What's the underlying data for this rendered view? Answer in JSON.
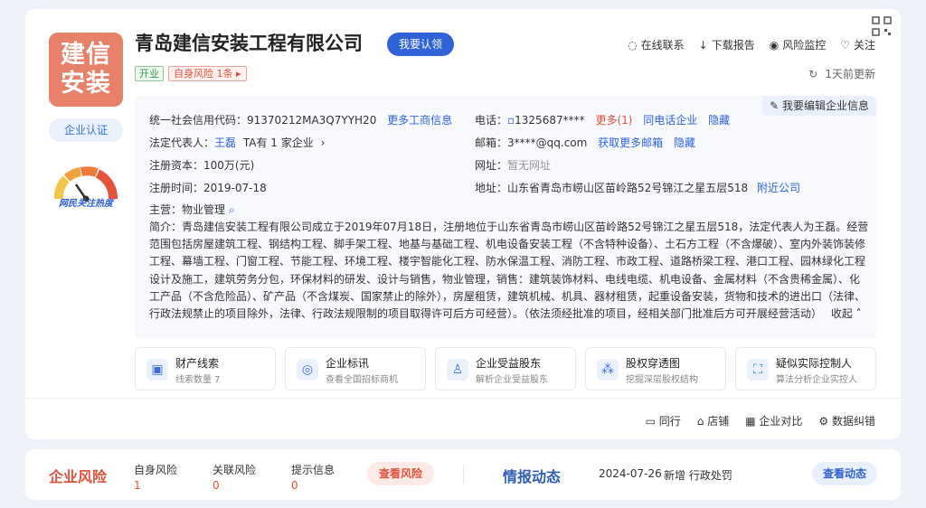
{
  "company": {
    "logo_text_line1": "建信",
    "logo_text_line2": "安装",
    "name": "青岛建信安装工程有限公司",
    "claim_button": "我要认领",
    "status_tag": "开业",
    "risk_tag": "自身风险 1条",
    "certification": "企业认证",
    "heat_label": "网民关注热度"
  },
  "top_actions": {
    "contact": "在线联系",
    "download": "下载报告",
    "monitor": "风险监控",
    "follow": "关注",
    "update_time": "1天前更新"
  },
  "info": {
    "edit_button": "我要编辑企业信息",
    "credit_code_label": "统一社会信用代码：",
    "credit_code": "91370212MA3Q7YYH20",
    "more_business": "更多工商信息",
    "phone_label": "电话：",
    "phone": "1325687****",
    "phone_more": "更多(1)",
    "same_phone": "同电话企业",
    "hide": "隐藏",
    "legal_rep_label": "法定代表人：",
    "legal_rep": "王磊",
    "legal_rep_companies": "TA有 1 家企业",
    "email_label": "邮箱：",
    "email": "3****@qq.com",
    "more_email": "获取更多邮箱",
    "hide2": "隐藏",
    "capital_label": "注册资本：",
    "capital": "100万(元)",
    "website_label": "网址：",
    "website": "暂无网址",
    "reg_date_label": "注册时间：",
    "reg_date": "2019-07-18",
    "address_label": "地址：",
    "address": "山东省青岛市崂山区苗岭路52号锦江之星五层518",
    "nearby": "附近公司",
    "main_business_label": "主营：",
    "main_business": "物业管理",
    "description": "简介：青岛建信安装工程有限公司成立于2019年07月18日，注册地位于山东省青岛市崂山区苗岭路52号锦江之星五层518，法定代表人为王磊。经营范围包括房屋建筑工程、钢结构工程、脚手架工程、地基与基础工程、机电设备安装工程（不含特种设备）、土石方工程（不含爆破）、室内外装饰装修工程、幕墙工程、门窗工程、节能工程、环境工程、楼宇智能化工程、防水保温工程、消防工程、市政工程、道路桥梁工程、港口工程、园林绿化工程设计及施工，建筑劳务分包，环保材料的研发、设计与销售，物业管理，销售：建筑装饰材料、电线电缆、机电设备、金属材料（不含贵稀金属）、化工产品（不含危险品）、矿产品（不含煤炭、国家禁止的除外），房屋租赁，建筑机械、机具、器材租赁，起重设备安装，货物和技术的进出口（法律、行政法规禁止的项目除外，法律、行政法规限制的项目取得许可后方可经营）。（依法须经批准的项目，经相关部门批准后方可开展经营活动）",
    "collapse": "收起"
  },
  "features": [
    {
      "title": "财产线索",
      "sub": "线索数量 7",
      "icon": "wallet-icon"
    },
    {
      "title": "企业标讯",
      "sub": "查看全国招标商机",
      "icon": "bid-icon"
    },
    {
      "title": "企业受益股东",
      "sub": "解析企业受益股东",
      "icon": "person-icon"
    },
    {
      "title": "股权穿透图",
      "sub": "挖掘深层股权结构",
      "icon": "tree-icon"
    },
    {
      "title": "疑似实际控制人",
      "sub": "算法分析企业实控人",
      "icon": "controller-icon"
    }
  ],
  "bottom_actions": {
    "peers": "同行",
    "shop": "店铺",
    "compare": "企业对比",
    "correct": "数据纠错"
  },
  "risk": {
    "title": "企业风险",
    "self_label": "自身风险",
    "self_count": "1",
    "related_label": "关联风险",
    "related_count": "0",
    "hint_label": "提示信息",
    "hint_count": "0",
    "view_button": "查看风险"
  },
  "intel": {
    "title": "情报动态",
    "date": "2024-07-26",
    "item": "新增 行政处罚",
    "button": "查看动态"
  }
}
